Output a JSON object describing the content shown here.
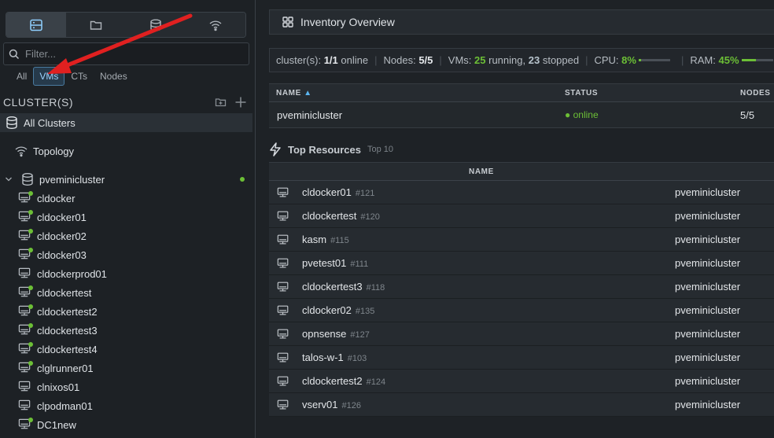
{
  "sidebar": {
    "view_tabs": [
      {
        "icon": "server-icon",
        "active": true
      },
      {
        "icon": "folder-icon",
        "active": false
      },
      {
        "icon": "database-icon",
        "active": false
      },
      {
        "icon": "wifi-icon",
        "active": false
      }
    ],
    "filter_placeholder": "Filter...",
    "type_filters": [
      "All",
      "VMs",
      "CTs",
      "Nodes"
    ],
    "active_type_filter": "VMs",
    "section_title": "CLUSTER(S)",
    "all_clusters": "All Clusters",
    "topology": "Topology",
    "cluster_name": "pveminicluster",
    "vms": [
      "cldocker",
      "cldocker01",
      "cldocker02",
      "cldocker03",
      "cldockerprod01",
      "cldockertest",
      "cldockertest2",
      "cldockertest3",
      "cldockertest4",
      "clglrunner01",
      "clnixos01",
      "clpodman01",
      "DC1new"
    ],
    "vm_running": [
      true,
      true,
      true,
      true,
      false,
      true,
      true,
      true,
      true,
      true,
      false,
      false,
      true
    ]
  },
  "main": {
    "title": "Inventory Overview",
    "summary": {
      "clusters_label": "cluster(s):",
      "clusters_value": "1/1",
      "clusters_status": "online",
      "nodes_label": "Nodes:",
      "nodes_value": "5/5",
      "vms_label": "VMs:",
      "vms_running": "25",
      "running_label": "running,",
      "vms_stopped": "23",
      "stopped_label": "stopped",
      "cpu_label": "CPU:",
      "cpu_value": "8%",
      "cpu_fraction": 0.08,
      "ram_label": "RAM:",
      "ram_value": "45%",
      "ram_fraction": 0.45
    },
    "cluster_table": {
      "headers": {
        "name": "NAME",
        "status": "STATUS",
        "nodes": "NODES"
      },
      "row": {
        "name": "pveminicluster",
        "status": "online",
        "nodes": "5/5"
      }
    },
    "top_resources": {
      "title": "Top Resources",
      "subtitle": "Top 10",
      "header_name": "NAME",
      "rows": [
        {
          "name": "cldocker01",
          "id": "#121",
          "cluster": "pveminicluster"
        },
        {
          "name": "cldockertest",
          "id": "#120",
          "cluster": "pveminicluster"
        },
        {
          "name": "kasm",
          "id": "#115",
          "cluster": "pveminicluster"
        },
        {
          "name": "pvetest01",
          "id": "#111",
          "cluster": "pveminicluster"
        },
        {
          "name": "cldockertest3",
          "id": "#118",
          "cluster": "pveminicluster"
        },
        {
          "name": "cldocker02",
          "id": "#135",
          "cluster": "pveminicluster"
        },
        {
          "name": "opnsense",
          "id": "#127",
          "cluster": "pveminicluster"
        },
        {
          "name": "talos-w-1",
          "id": "#103",
          "cluster": "pveminicluster"
        },
        {
          "name": "cldockertest2",
          "id": "#124",
          "cluster": "pveminicluster"
        },
        {
          "name": "vserv01",
          "id": "#126",
          "cluster": "pveminicluster"
        }
      ]
    }
  },
  "colors": {
    "accent": "#8fd0ff",
    "online": "#6cbf36",
    "annotation_arrow": "#e02020"
  }
}
